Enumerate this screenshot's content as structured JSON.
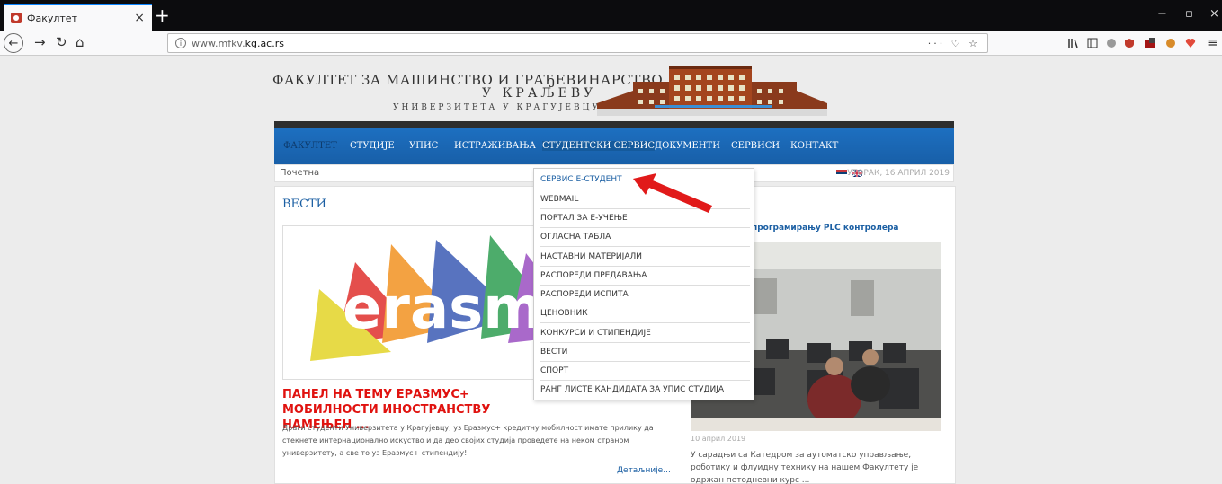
{
  "browser": {
    "tab_title": "Факултет",
    "tab_close": "×",
    "new_tab": "+",
    "url_prefix": "www.mfkv.",
    "url_host": "kg.ac.rs",
    "url_actions": "··· ♡ ☆",
    "window_controls": [
      "−",
      "▫",
      "×"
    ]
  },
  "header": {
    "line1": "ФАКУЛТЕТ ЗА МАШИНСТВО И ГРАЂЕВИНАРСТВО",
    "line2": "У КРАЉЕВУ",
    "line3": "УНИВЕРЗИТЕТА У КРАГУЈЕВЦУ"
  },
  "menu": {
    "items": [
      "ФАКУЛТЕТ",
      "СТУДИЈЕ",
      "УПИС",
      "ИСТРАЖИВАЊА",
      "СТУДЕНТСКИ СЕРВИС",
      "ДОКУМЕНТИ",
      "СЕРВИСИ",
      "КОНТАКТ"
    ]
  },
  "breadcrumb": "Почетна",
  "date": "УТОРАК, 16 АПРИЛ 2019",
  "dropdown": {
    "items": [
      "СЕРВИС Е-СТУДЕНТ",
      "WEBMAIL",
      "ПОРТАЛ ЗА Е-УЧЕЊЕ",
      "ОГЛАСНА ТАБЛА",
      "НАСТАВНИ МАТЕРИЈАЛИ",
      "РАСПОРЕДИ ПРЕДАВАЊА",
      "РАСПОРЕДИ ИСПИТА",
      "ЦЕНОВНИК",
      "КОНКУРСИ И СТИПЕНДИЈЕ",
      "ВЕСТИ",
      "СПОРТ",
      "РАНГ ЛИСТЕ КАНДИДАТА ЗА УПИС СТУДИЈА"
    ]
  },
  "news": {
    "heading": "ВЕСТИ",
    "banner_text": "erasm",
    "main_title": "ПАНЕЛ НА ТЕМУ ЕРАЗМУС+ МОБИЛНОСТИ ИНОСТРАНСТВУ НАМЕЊЕН ...",
    "main_body": "Драги студенти Универзитета у Крагујевцу,  уз Еразмус+ кредитну мобилност имате прилику да стекнете интернационално искуство и да део својих студија проведете на неком страном универзитету, а све то уз Еразмус+ стипендију!",
    "more": "Детаљније...",
    "side_title": "програмирању PLC контролера",
    "side_date": "10 април 2019",
    "side_body": "У сарадњи са Катедром за аутоматско управљање, роботику и флуидну технику на нашем Факултету је одржан петодневни курс ..."
  }
}
